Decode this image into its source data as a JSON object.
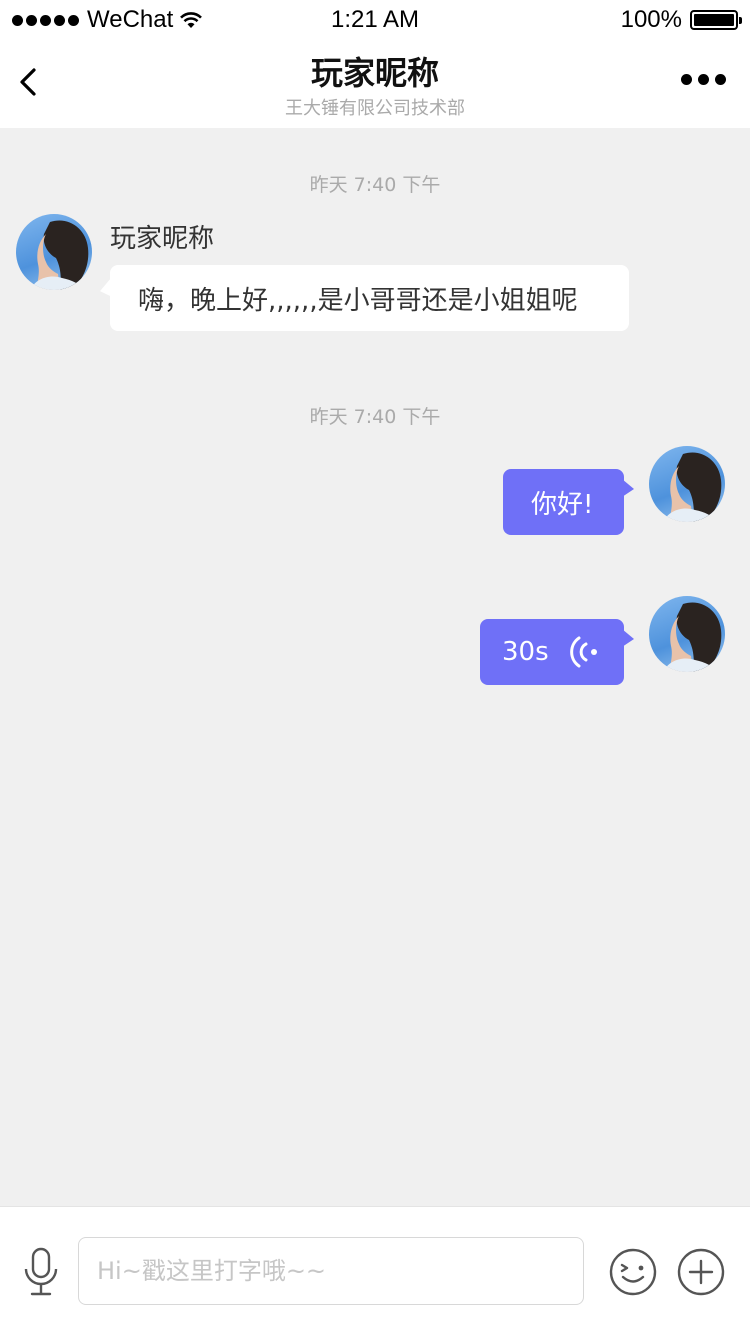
{
  "status_bar": {
    "carrier": "WeChat",
    "time": "1:21 AM",
    "battery": "100%"
  },
  "nav": {
    "title": "玩家昵称",
    "subtitle": "王大锤有限公司技术部"
  },
  "messages": [
    {
      "timestamp": "昨天 7:40 下午",
      "direction": "incoming",
      "sender": "玩家昵称",
      "text": "嗨，晚上好,,,,,,是小哥哥还是小姐姐呢"
    },
    {
      "timestamp": "昨天 7:40 下午",
      "direction": "outgoing",
      "text": "你好!"
    },
    {
      "direction": "outgoing",
      "type": "voice",
      "duration": "30s"
    }
  ],
  "input": {
    "placeholder": "Hi~戳这里打字哦~~"
  },
  "colors": {
    "accent": "#6f70f7",
    "background": "#f0f0f0"
  }
}
